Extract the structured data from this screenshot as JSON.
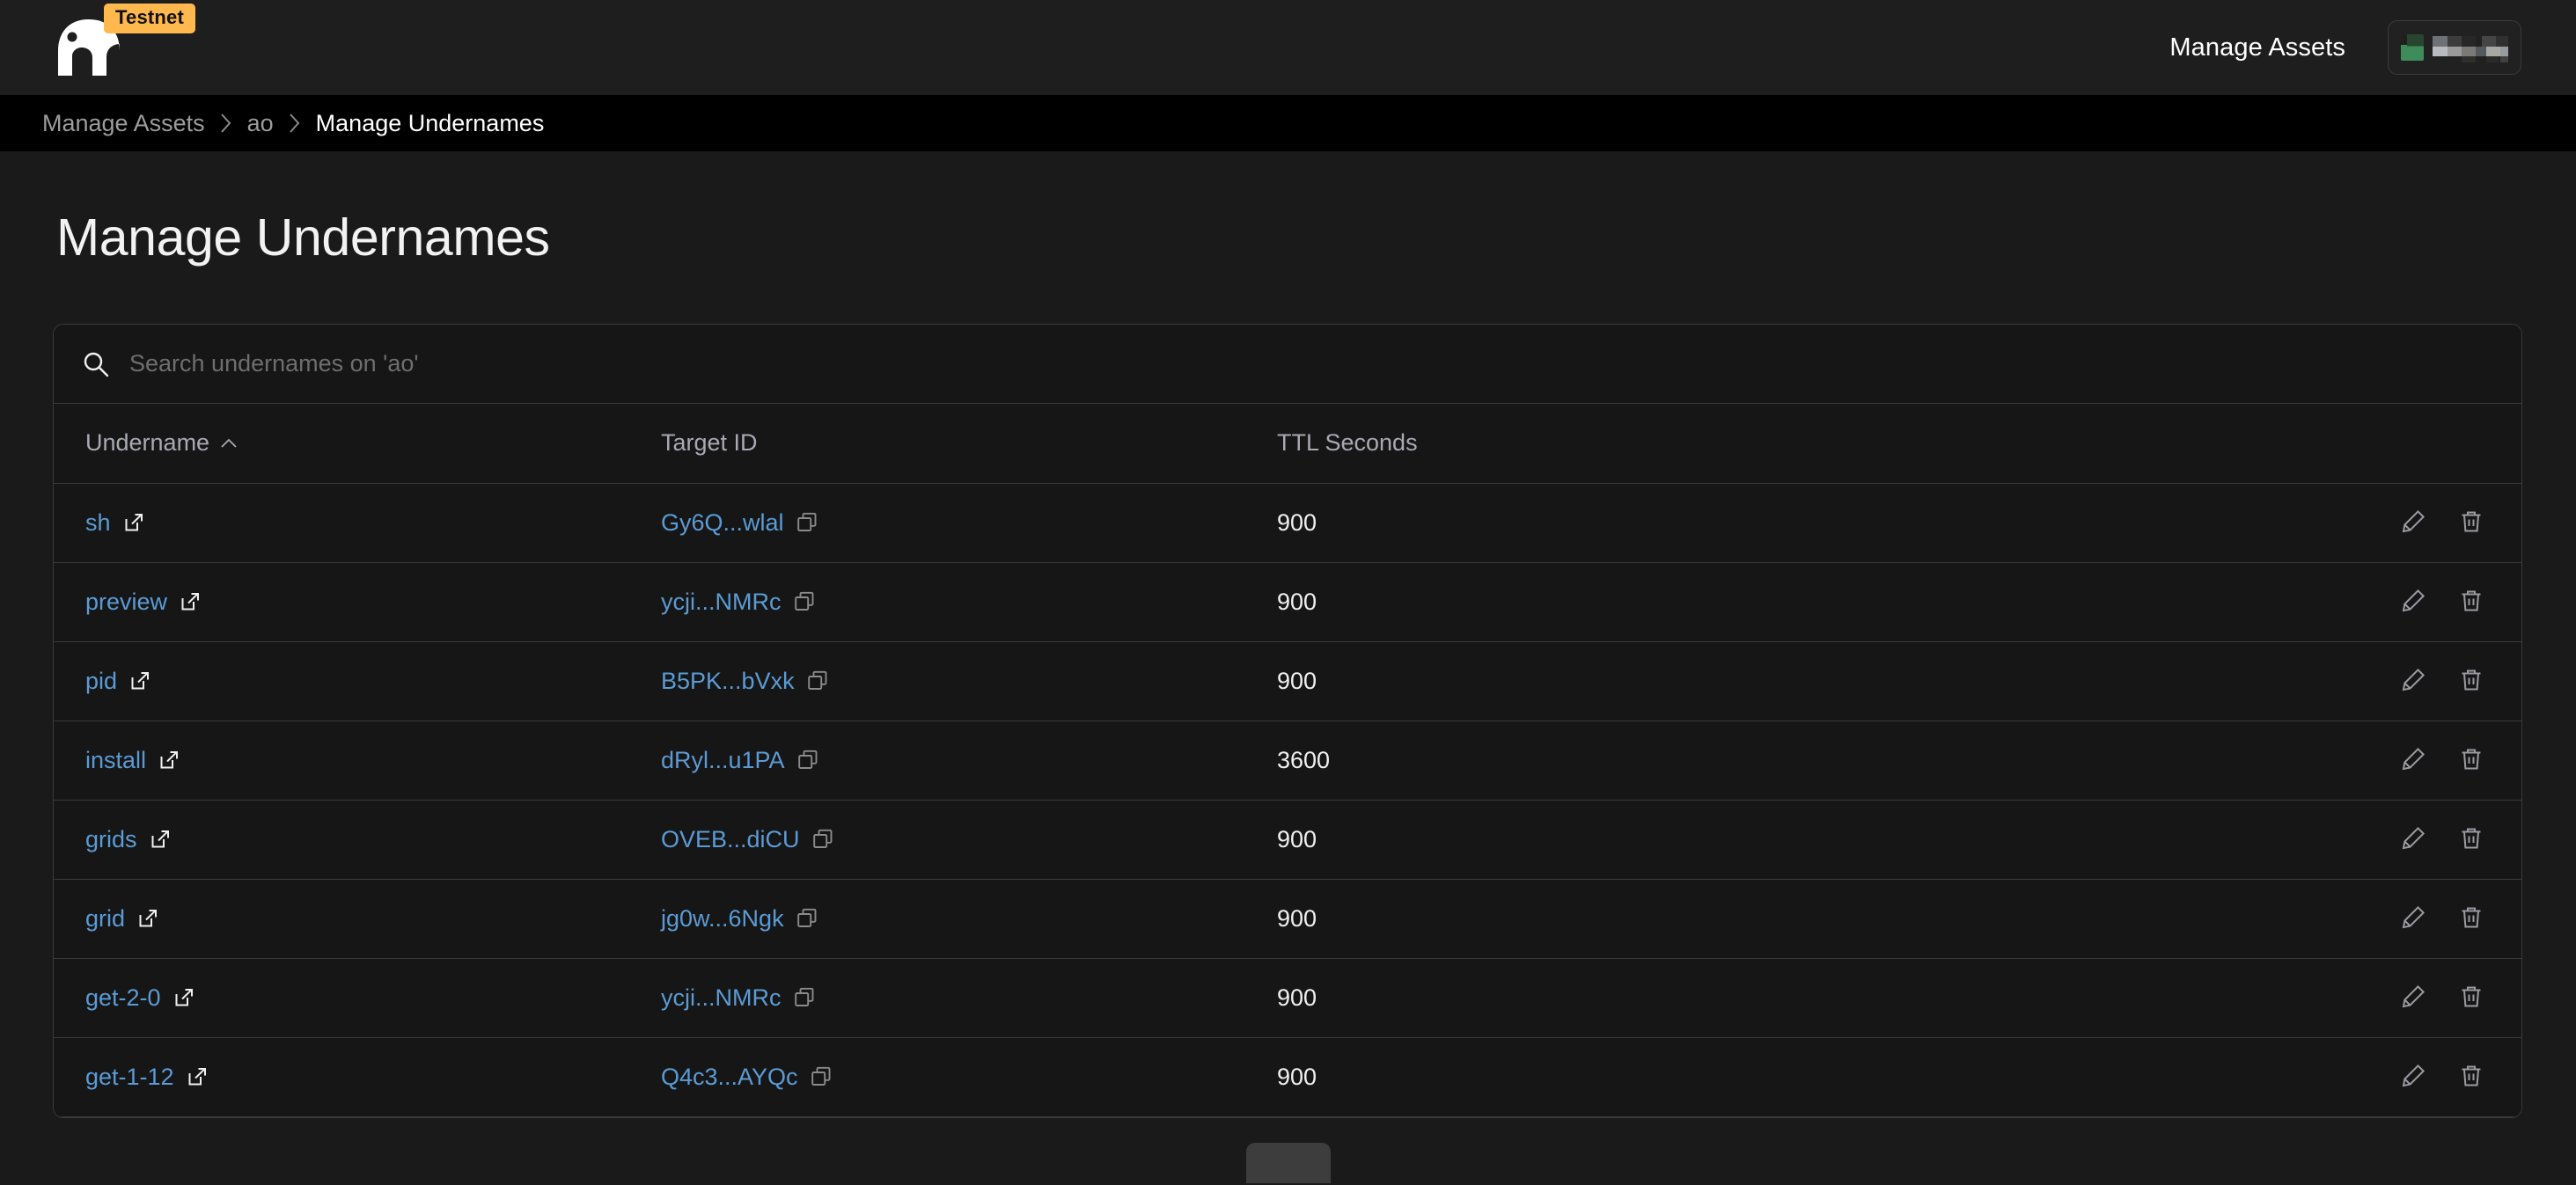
{
  "header": {
    "logo_icon": "elephant-logo",
    "testnet_badge": "Testnet",
    "manage_assets_label": "Manage Assets",
    "wallet_icon": "wallet-avatar-icon",
    "wallet_address_redacted": "██████"
  },
  "breadcrumb": {
    "items": [
      {
        "label": "Manage Assets",
        "current": false
      },
      {
        "label": "ao",
        "current": false
      },
      {
        "label": "Manage Undernames",
        "current": true
      }
    ],
    "separator": "›"
  },
  "page": {
    "title": "Manage Undernames"
  },
  "search": {
    "icon": "search-icon",
    "placeholder": "Search undernames on 'ao'",
    "value": ""
  },
  "table": {
    "columns": [
      {
        "key": "undername",
        "label": "Undername",
        "sorted": true,
        "sort_direction": "asc",
        "sort_glyph": "∧"
      },
      {
        "key": "target",
        "label": "Target ID",
        "sorted": false
      },
      {
        "key": "ttl",
        "label": "TTL Seconds",
        "sorted": false
      },
      {
        "key": "actions",
        "label": "",
        "sorted": false
      }
    ],
    "row_icons": {
      "external_link": "external-link-icon",
      "copy": "copy-icon",
      "edit": "pencil-icon",
      "delete": "trash-icon"
    },
    "rows": [
      {
        "undername": "sh",
        "target_id": "Gy6Q...wlal",
        "ttl_seconds": "900"
      },
      {
        "undername": "preview",
        "target_id": "ycji...NMRc",
        "ttl_seconds": "900"
      },
      {
        "undername": "pid",
        "target_id": "B5PK...bVxk",
        "ttl_seconds": "900"
      },
      {
        "undername": "install",
        "target_id": "dRyl...u1PA",
        "ttl_seconds": "3600"
      },
      {
        "undername": "grids",
        "target_id": "OVEB...diCU",
        "ttl_seconds": "900"
      },
      {
        "undername": "grid",
        "target_id": "jg0w...6Ngk",
        "ttl_seconds": "900"
      },
      {
        "undername": "get-2-0",
        "target_id": "ycji...NMRc",
        "ttl_seconds": "900"
      },
      {
        "undername": "get-1-12",
        "target_id": "Q4c3...AYQc",
        "ttl_seconds": "900"
      }
    ]
  },
  "colors": {
    "page_background": "#1a1a1a",
    "header_background": "#1e1e1e",
    "breadcrumb_background": "#000000",
    "card_background": "#161616",
    "border": "#3a3a3a",
    "link_blue": "#5b9bd5",
    "badge_orange": "#ffb84d",
    "text_primary": "#f0f0f0",
    "text_muted": "#9c9c9c"
  }
}
